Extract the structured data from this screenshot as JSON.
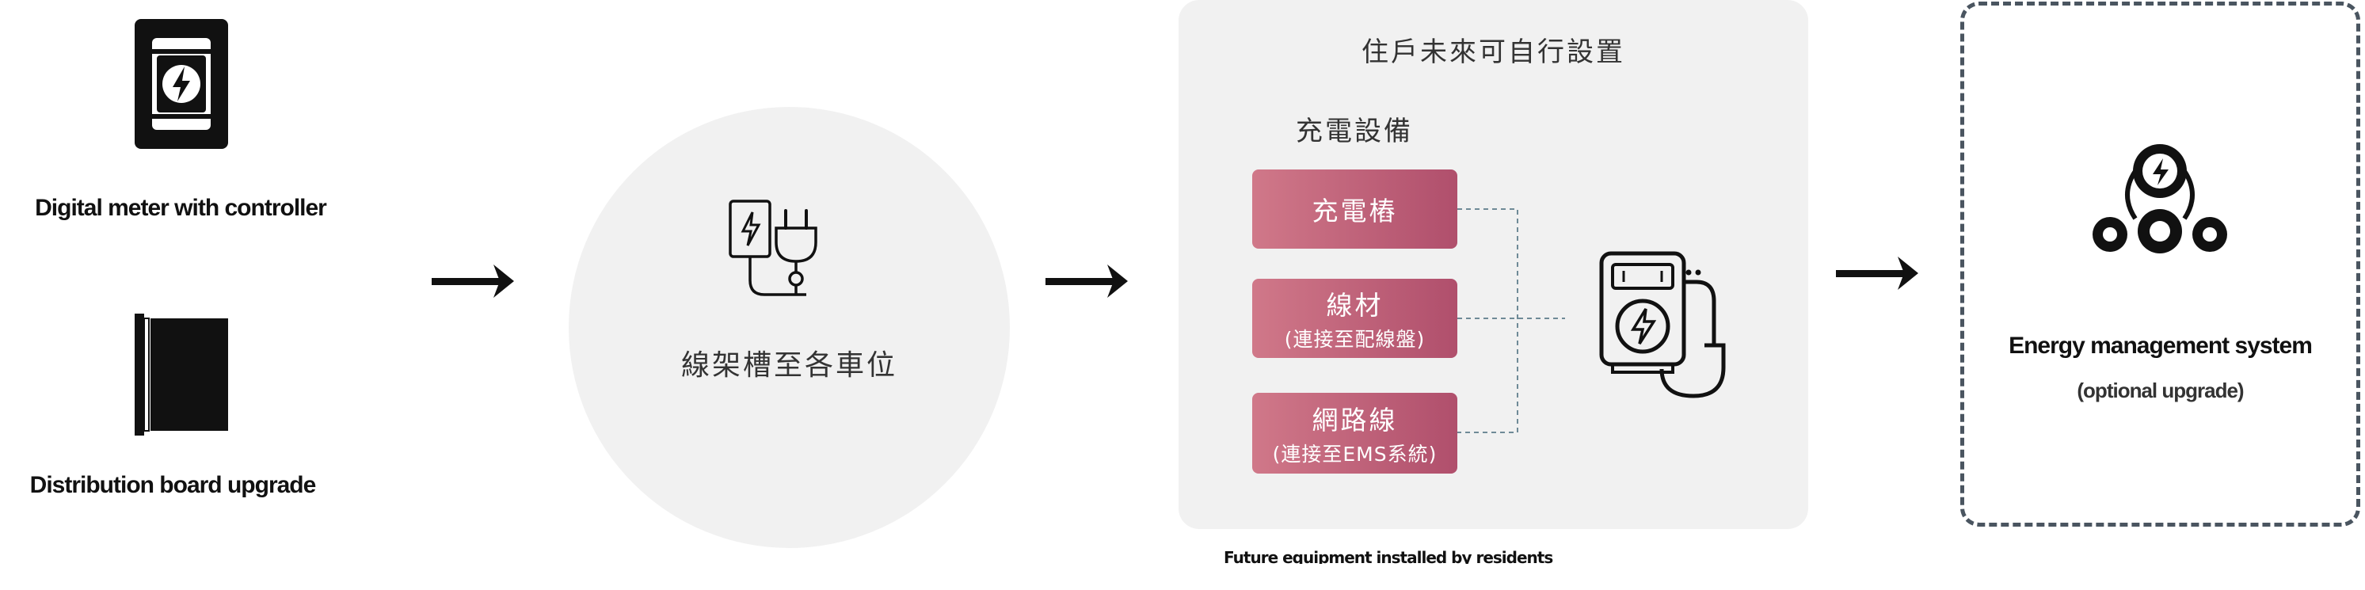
{
  "left_column": {
    "item1_caption": "Digital meter with controller",
    "item2_caption": "Distribution board upgrade"
  },
  "circle": {
    "label": "線架槽至各車位"
  },
  "panel": {
    "title": "住戶未來可自行設置",
    "subtitle": "充電設備",
    "items": [
      {
        "main": "充電樁",
        "sub": ""
      },
      {
        "main": "線材",
        "sub": "(連接至配線盤)"
      },
      {
        "main": "網路線",
        "sub": "(連接至EMS系統)"
      }
    ],
    "footnote": "Future equipment installed by residents"
  },
  "right_box": {
    "caption_line1": "Energy management system",
    "caption_line2": "(optional upgrade)"
  },
  "colors": {
    "pill_start": "#d07889",
    "pill_end": "#b04f6c",
    "panel_bg": "#f1f1f1",
    "dashed_border": "#4a5560"
  }
}
